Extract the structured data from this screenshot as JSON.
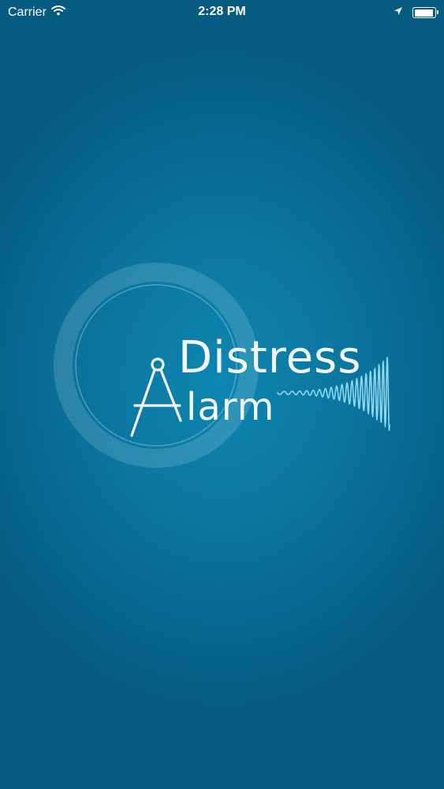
{
  "status_bar": {
    "carrier": "Carrier",
    "time": "2:28 PM",
    "battery_level": 0.92,
    "icons": [
      "wifi-icon",
      "location-arrow-icon",
      "battery-icon"
    ]
  },
  "splash": {
    "logo_line1": "Distress",
    "logo_letter": "A",
    "logo_line2_rest": "larm",
    "colors": {
      "background_center": "#0d86b1",
      "background_edge": "#065b80",
      "text": "#f2f7fa",
      "wave": "#8fd8f2"
    }
  }
}
